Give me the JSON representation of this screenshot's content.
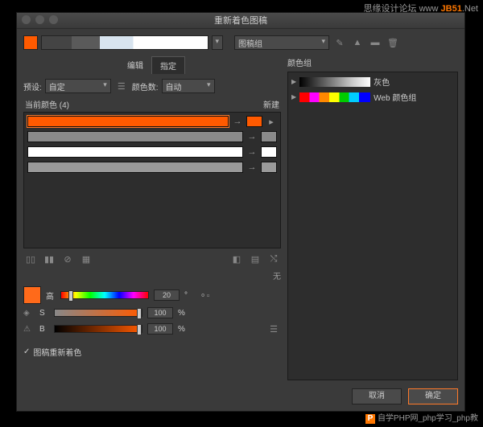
{
  "watermarks": {
    "top_left": "思缘设计论坛 www",
    "top_right_brand": "JB51",
    "top_right_suffix": ".Net",
    "bottom": "自学PHP网_php学习_php教",
    "bottom_badge": "P"
  },
  "window": {
    "title": "重新着色图稿"
  },
  "toprow": {
    "group_dd": "图稿组"
  },
  "tabs": {
    "edit": "编辑",
    "assign": "指定"
  },
  "preset": {
    "label": "预设:",
    "value": "自定",
    "count_label": "颜色数:",
    "count_value": "自动"
  },
  "current": {
    "label": "当前颜色 (4)",
    "new_label": "新建"
  },
  "rows": [
    {
      "bar_color": "#ff5a00",
      "target": "#ff5a00",
      "selected": true
    },
    {
      "bar_color": "#8a8a8a",
      "target": "#8a8a8a",
      "selected": false
    },
    {
      "bar_color": "#ffffff",
      "target": "#ffffff",
      "selected": false
    },
    {
      "bar_color": "#9a9a9a",
      "target": "#9a9a9a",
      "selected": false
    }
  ],
  "right": {
    "section": "颜色组",
    "groups": [
      {
        "label": "灰色",
        "type": "gray"
      },
      {
        "label": "Web 颜色组",
        "type": "web"
      }
    ]
  },
  "none_label": "无",
  "sliders": {
    "h": {
      "label": "高",
      "value": "20",
      "unit": "°",
      "pos": 8
    },
    "s": {
      "label": "S",
      "value": "100",
      "unit": "%",
      "pos": 100
    },
    "b": {
      "label": "B",
      "value": "100",
      "unit": "%",
      "pos": 100
    }
  },
  "checkbox": {
    "label": "图稿重新着色"
  },
  "buttons": {
    "cancel": "取消",
    "ok": "确定"
  }
}
